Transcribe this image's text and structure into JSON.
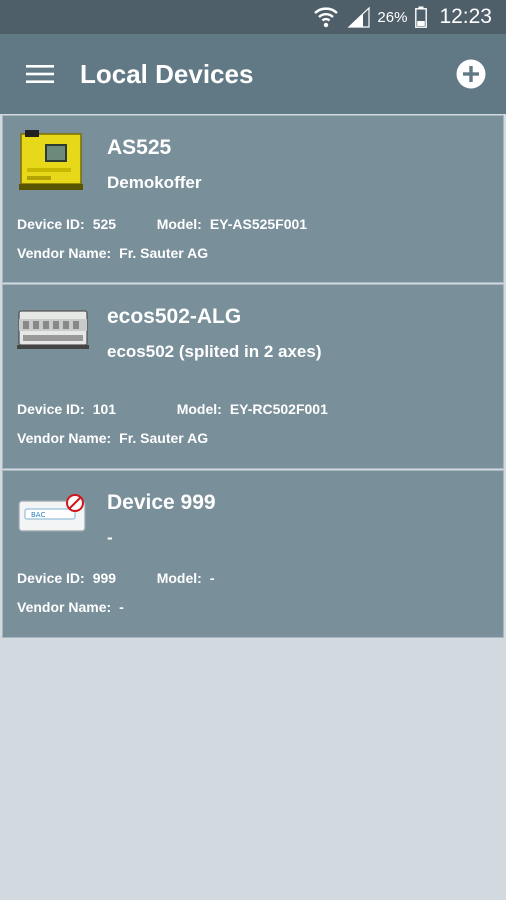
{
  "status": {
    "battery": "26%",
    "time": "12:23"
  },
  "appbar": {
    "title": "Local Devices",
    "icons": [
      "menu-icon",
      "add-circle-icon"
    ]
  },
  "labels": {
    "device_id": "Device ID:",
    "model": "Model:",
    "vendor": "Vendor Name:"
  },
  "devices": [
    {
      "name": "AS525",
      "description": "Demokoffer",
      "device_id": "525",
      "model": "EY-AS525F001",
      "vendor": "Fr. Sauter AG",
      "icon": "yellow-controller-icon"
    },
    {
      "name": "ecos502-ALG",
      "description": "ecos502 (splited in 2 axes)",
      "device_id": "101",
      "model": "EY-RC502F001",
      "vendor": "Fr. Sauter AG",
      "icon": "din-rail-module-icon"
    },
    {
      "name": "Device 999",
      "description": "-",
      "device_id": "999",
      "model": "-",
      "vendor": "-",
      "icon": "bacnet-device-icon"
    }
  ],
  "colors": {
    "status_bar": "#4f5f69",
    "app_bar": "#617985",
    "card": "#798f9a",
    "background": "#d3dadf"
  }
}
